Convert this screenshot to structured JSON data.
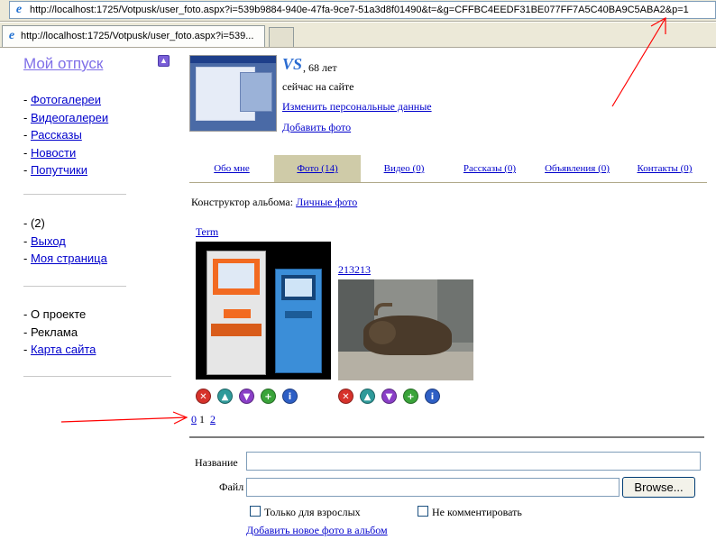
{
  "browser": {
    "url": "http://localhost:1725/Votpusk/user_foto.aspx?i=539b9884-940e-47fa-9ce7-51a3d8f01490&t=&g=CFFBC4EEDF31BE077FF7A5C40BA9C5ABA2&p=1",
    "tab_title": "http://localhost:1725/Votpusk/user_foto.aspx?i=539...",
    "ie_icon": "e"
  },
  "sidebar": {
    "site_title": "Мой отпуск",
    "up_button": "▲",
    "group1": [
      "Фотогалереи",
      "Видеогалереи",
      "Рассказы",
      "Новости",
      "Попутчики"
    ],
    "group2_count": "(2)",
    "group2_links": [
      "Выход",
      "Моя страница"
    ],
    "group3_about": "О проекте",
    "group3_ads": "Реклама",
    "group3_sitemap": "Карта сайта",
    "bullet": "- "
  },
  "profile": {
    "logo": "VS",
    "age": ", 68 лет",
    "status": "сейчас на сайте",
    "edit_link": "Изменить персональные данные",
    "add_photo_link": "Добавить фото"
  },
  "tabs": [
    {
      "label": "Обо мне"
    },
    {
      "label": "Фото (14)"
    },
    {
      "label": "Видео (0)"
    },
    {
      "label": "Рассказы (0)"
    },
    {
      "label": "Объявления (0)"
    },
    {
      "label": "Контакты (0)"
    }
  ],
  "constructor": {
    "label": "Конструктор альбома:",
    "album_link": "Личные фото"
  },
  "photos": [
    {
      "title": "Term"
    },
    {
      "title": "213213"
    }
  ],
  "photo_actions": [
    {
      "name": "delete-icon",
      "glyph": "✕",
      "color": "#d6322b"
    },
    {
      "name": "move-up-icon",
      "glyph": "▲",
      "color": "#2f9a9a"
    },
    {
      "name": "move-down-icon",
      "glyph": "▼",
      "color": "#8a3fc7"
    },
    {
      "name": "add-icon",
      "glyph": "+",
      "color": "#3aa43a"
    },
    {
      "name": "info-icon",
      "glyph": "i",
      "color": "#2e5fc5"
    }
  ],
  "pagination": {
    "pages": [
      "0",
      "1",
      "2"
    ]
  },
  "form": {
    "name_label": "Название",
    "file_label": "Файл",
    "browse_label": "Browse...",
    "adults_only_label": "Только для взрослых",
    "no_comments_label": "Не комментировать",
    "add_new_link": "Добавить новое фото в альбом"
  },
  "colors": {
    "link": "#0000cc",
    "site_title": "#7f6fe8",
    "active_tab": "#cfcba8",
    "annotation_arrow": "#ff0000"
  }
}
